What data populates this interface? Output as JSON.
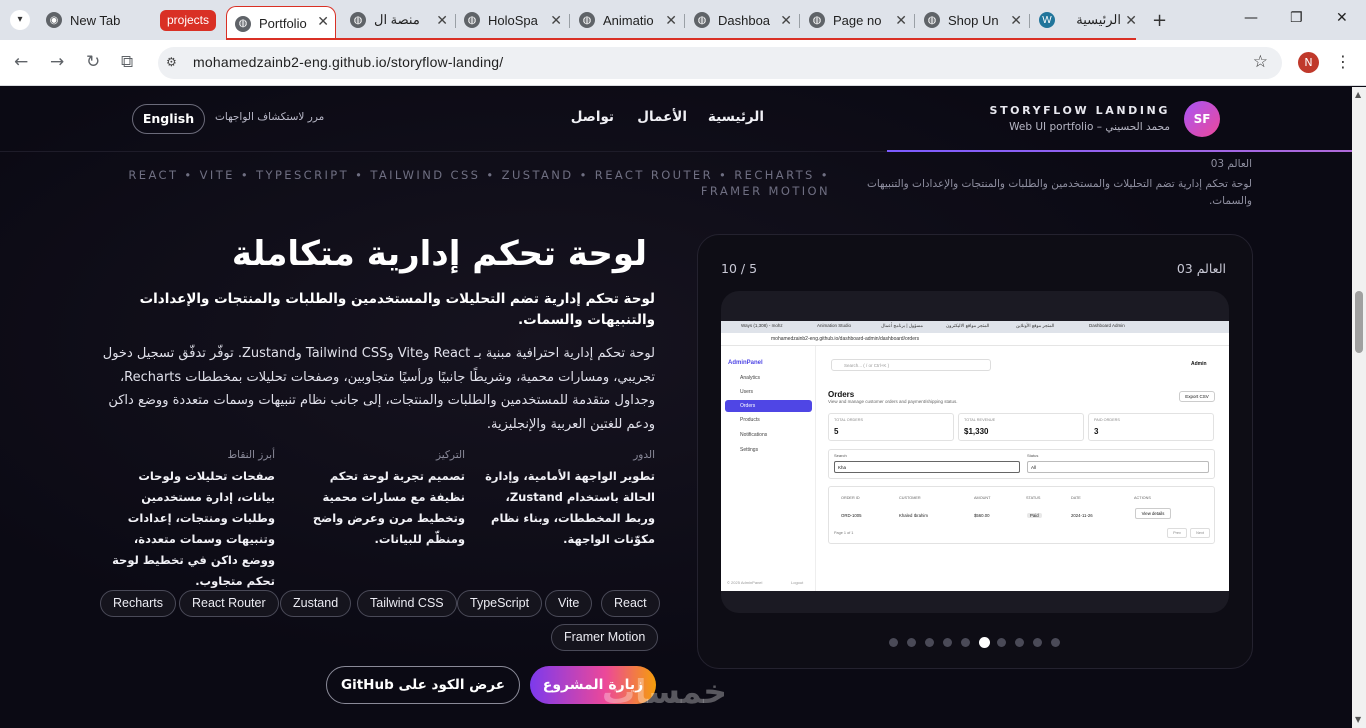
{
  "browser": {
    "tabs": [
      {
        "title": "New Tab",
        "icon": "chrome-icon",
        "color": "#5f6368"
      },
      {
        "title": "Portfolio",
        "icon": "globe-icon",
        "color": "#5f6368"
      },
      {
        "title": "منصة ال",
        "icon": "globe-icon",
        "color": "#5f6368"
      },
      {
        "title": "HoloSpa",
        "icon": "globe-icon",
        "color": "#5f6368"
      },
      {
        "title": "Animatio",
        "icon": "globe-icon",
        "color": "#5f6368"
      },
      {
        "title": "Dashboa",
        "icon": "globe-icon",
        "color": "#5f6368"
      },
      {
        "title": "Page no",
        "icon": "globe-icon",
        "color": "#5f6368"
      },
      {
        "title": "Shop Un",
        "icon": "globe-icon",
        "color": "#5f6368"
      },
      {
        "title": "الرئيسية",
        "icon": "wordpress-icon",
        "color": "#21759b"
      }
    ],
    "group_label": "projects",
    "group_color": "#d93025",
    "url": "mohamedzainb2-eng.github.io/storyflow-landing/",
    "profile_initial": "N"
  },
  "nav": {
    "logo_initials": "SF",
    "brand_title": "STORYFLOW LANDING",
    "brand_subtitle": "محمد الحسيني – Web UI portfolio",
    "links": [
      "الرئيسية",
      "الأعمال",
      "تواصل"
    ],
    "scroll_hint": "مرر لاستكشاف الواجهات",
    "language_button": "English"
  },
  "tech_strip": "REACT • VITE • TYPESCRIPT • TAILWIND CSS • ZUSTAND • REACT ROUTER • RECHARTS • FRAMER MOTION",
  "mini_label": {
    "world": "العالم 03",
    "desc": "لوحة تحكم إدارية تضم التحليلات والمستخدمين والطلبات والمنتجات والإعدادات والتنبيهات والسمات."
  },
  "project": {
    "title": "لوحة تحكم إدارية متكاملة",
    "subtitle": "لوحة تحكم إدارية تضم التحليلات والمستخدمين والطلبات والمنتجات والإعدادات والتنبيهات والسمات.",
    "description": "لوحة تحكم إدارية احترافية مبنية بـ React وVite وTailwind CSS وZustand. توفّر تدفّق تسجيل دخول تجريبي، ومسارات محمية، وشريطًا جانبيًا ورأسيًا متجاوبين، وصفحات تحليلات بمخططات Recharts، وجداول متقدمة للمستخدمين والطلبات والمنتجات، إلى جانب نظام تنبيهات وسمات متعددة ووضع داكن ودعم للغتين العربية والإنجليزية.",
    "columns": [
      {
        "label": "الدور",
        "text": "تطوير الواجهة الأمامية، وإدارة الحالة باستخدام Zustand، وربط المخططات، وبناء نظام مكوّنات الواجهة."
      },
      {
        "label": "التركيز",
        "text": "تصميم تجربة لوحة تحكم نظيفة مع مسارات محمية وتخطيط مرن وعرض واضح ومنظّم للبيانات."
      },
      {
        "label": "أبرز النقاط",
        "text": "صفحات تحليلات ولوحات بيانات، إدارة مستخدمين وطلبات ومنتجات، إعدادات وتنبيهات وسمات متعددة، ووضع داكن في تخطيط لوحة تحكم متجاوب."
      }
    ],
    "tech_chips": [
      "React",
      "Vite",
      "TypeScript",
      "Tailwind CSS",
      "Zustand",
      "React Router",
      "Recharts",
      "Framer Motion"
    ],
    "visit_button": "زيارة المشروع",
    "github_button": "عرض الكود على GitHub"
  },
  "carousel": {
    "counter": "10 / 5",
    "world": "العالم 03",
    "total_dots": 10,
    "active_dot": 5
  },
  "screenshot": {
    "tabs": [
      "Ways (1,308) - mohz",
      "Animation Studio",
      "مسؤول | برنامج أعمال",
      "المتجر مواقع الاليكترون",
      "المتجر موقع الأونلاين",
      "Dashboard Admin"
    ],
    "url": "mohamedzainb2-eng.github.io/dashboard-admin/dashboard/orders",
    "brand": "AdminPanel",
    "menu": [
      "Analytics",
      "Users",
      "Orders",
      "Products",
      "Notifications",
      "Settings"
    ],
    "footer": "© 2025 AdminPanel",
    "logout": "Logout",
    "search_placeholder": "Search... ( / or Ctrl+K )",
    "admin": "Admin",
    "title": "Orders",
    "subtitle": "View and manage customer orders and payment/shipping status.",
    "export": "Export CSV",
    "stats": [
      {
        "label": "TOTAL ORDERS",
        "value": "5"
      },
      {
        "label": "TOTAL REVENUE",
        "value": "$1,330"
      },
      {
        "label": "PAID ORDERS",
        "value": "3"
      }
    ],
    "search_label": "Search",
    "search_value": "Kha",
    "status_label": "Status",
    "status_value": "All",
    "headers": [
      "ORDER ID",
      "CUSTOMER",
      "AMOUNT",
      "STATUS",
      "DATE",
      "ACTIONS"
    ],
    "row": [
      "ORD-1005",
      "Khaled Ibrahim",
      "$560.00",
      "Paid",
      "2024-11-26",
      "View details"
    ],
    "pagination": "Page 1 of 1",
    "prev": "Prev",
    "next": "Next"
  },
  "watermark": "خمسات"
}
